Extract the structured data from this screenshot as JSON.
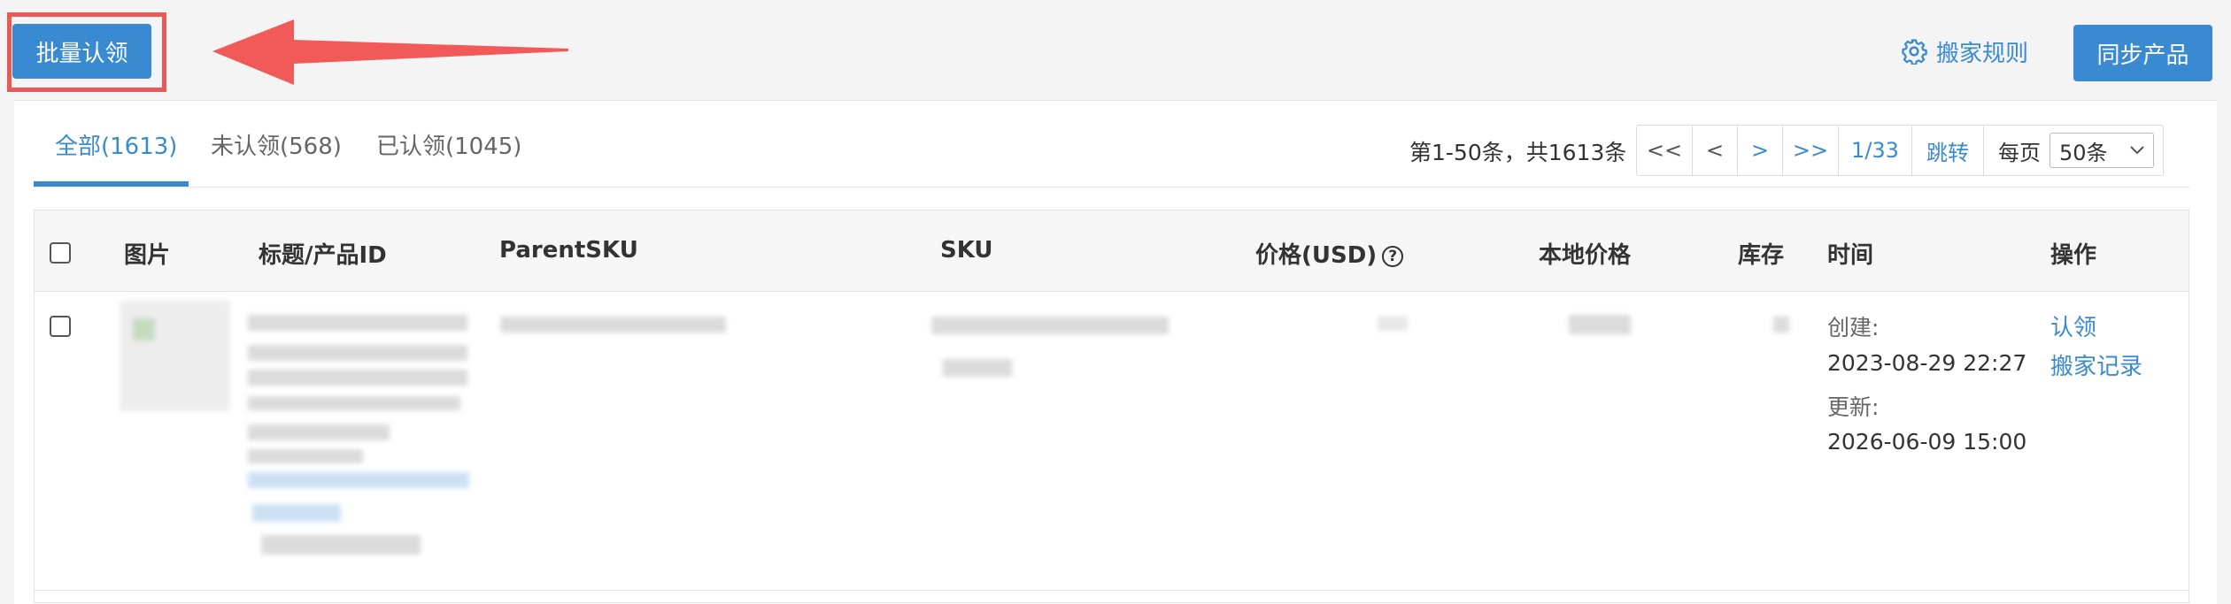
{
  "toolbar": {
    "claim_button": "批量认领",
    "rules_link": "搬家规则",
    "sync_button": "同步产品"
  },
  "tabs": [
    {
      "label": "全部(1613)",
      "active": true
    },
    {
      "label": "未认领(568)",
      "active": false
    },
    {
      "label": "已认领(1045)",
      "active": false
    }
  ],
  "pagination": {
    "range_text": "第1-50条，共1613条",
    "first": "<<",
    "prev": "<",
    "next": ">",
    "last": ">>",
    "page_indicator": "1/33",
    "jump": "跳转",
    "per_page_label": "每页",
    "per_page_value": "50条"
  },
  "table": {
    "headers": {
      "image": "图片",
      "title": "标题/产品ID",
      "parent_sku": "ParentSKU",
      "sku": "SKU",
      "price": "价格(USD)",
      "local_price": "本地价格",
      "stock": "库存",
      "time": "时间",
      "actions": "操作"
    },
    "rows": [
      {
        "created_label": "创建:",
        "created": "2023-08-29 22:27",
        "updated_label": "更新:",
        "updated": "2026-06-09 15:00",
        "action_claim": "认领",
        "action_history": "搬家记录"
      }
    ]
  },
  "colors": {
    "accent": "#3a8ad1",
    "highlight_frame": "#e85a57",
    "arrow": "#f25a5a"
  }
}
